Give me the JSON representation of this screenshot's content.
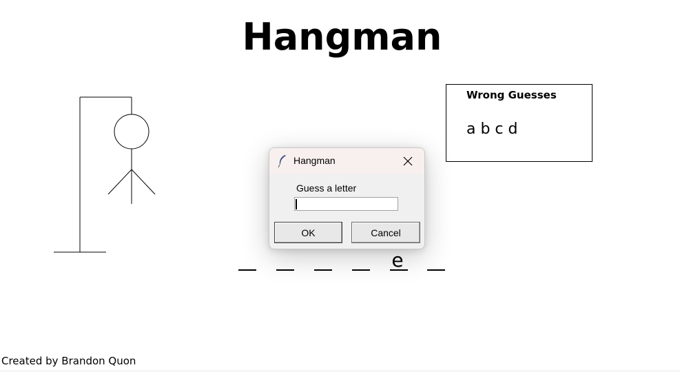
{
  "app": {
    "title": "Hangman"
  },
  "wrong_guesses": {
    "heading": "Wrong Guesses",
    "letters": "a b c d"
  },
  "word": {
    "slots": [
      "",
      "",
      "",
      "",
      "e",
      ""
    ]
  },
  "footer": {
    "credit": "Created by Brandon Quon"
  },
  "dialog": {
    "title": "Hangman",
    "prompt": "Guess a letter",
    "input_value": "",
    "ok_label": "OK",
    "cancel_label": "Cancel",
    "app_icon": "feather-icon",
    "close_icon": "close-icon"
  },
  "colors": {
    "line": "#000000",
    "dialog_bg": "#f0f0f0",
    "dialog_titlebar": "#f7f0ee"
  }
}
